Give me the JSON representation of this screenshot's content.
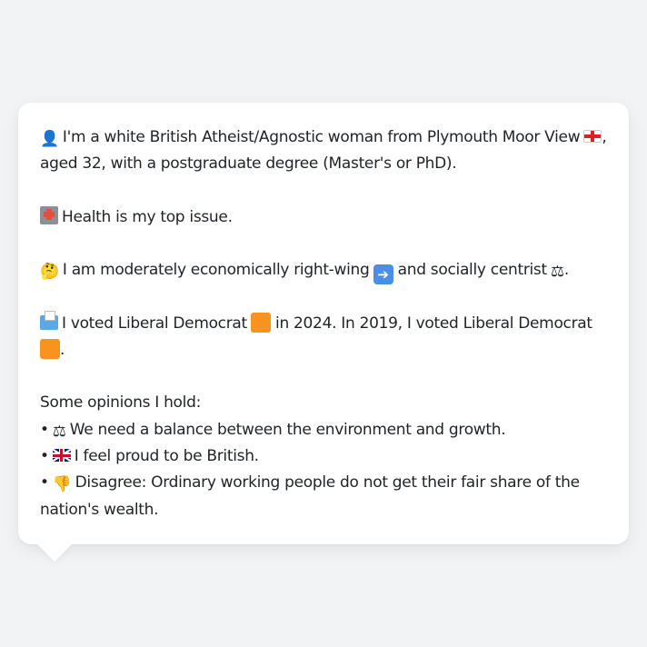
{
  "message": {
    "intro": {
      "icon": "bust-in-silhouette-icon",
      "text_before_flag": "I'm a white British Atheist/Agnostic woman from Plymouth Moor View",
      "flag": "england-flag-icon",
      "text_after_flag": ", aged 32, with a postgraduate degree (Master's or PhD)."
    },
    "top_issue": {
      "icon": "hospital-icon",
      "text": "Health is my top issue."
    },
    "position": {
      "icon": "thinking-face-icon",
      "text_part1": "I am moderately economically right-wing",
      "arrow_icon": "right-arrow-icon",
      "text_part2": "and socially centrist",
      "scales_icon": "balance-scale-icon",
      "text_end": "."
    },
    "voting": {
      "icon": "ballot-box-icon",
      "text_part1": "I voted Liberal Democrat",
      "party_icon": "orange-square-icon",
      "text_part2": "in 2024. In 2019, I voted Liberal Democrat",
      "text_end": "."
    },
    "opinions": {
      "heading": "Some opinions I hold:",
      "items": [
        {
          "bullet": "•",
          "icon": "balance-scale-icon",
          "text": "We need a balance between the environment and growth."
        },
        {
          "bullet": "•",
          "icon": "uk-flag-icon",
          "text": "I feel proud to be British."
        },
        {
          "bullet": "•",
          "icon": "thumbs-down-icon",
          "text": "Disagree: Ordinary working people do not get their fair share of the nation's wealth."
        }
      ]
    }
  },
  "colors": {
    "background": "#f2f3f5",
    "bubble": "#ffffff",
    "text": "#1f2328",
    "party_orange": "#f7931e"
  }
}
